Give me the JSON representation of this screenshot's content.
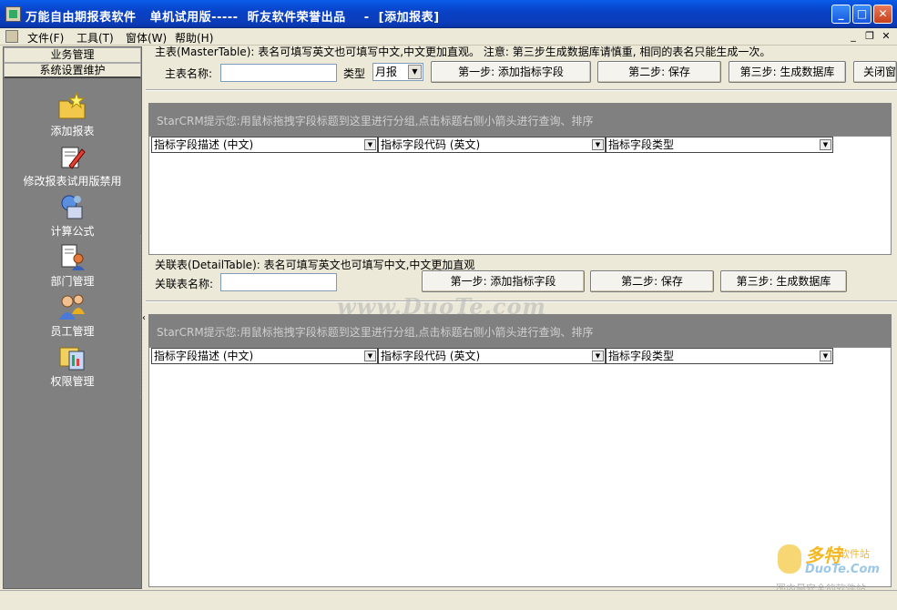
{
  "window": {
    "title": "万能自由期报表软件   单机试用版-----  昕友软件荣誉出品    -  [添加报表]",
    "minimize_glyph": "_",
    "maximize_glyph": "□",
    "close_glyph": "✕"
  },
  "menubar": {
    "items": [
      "文件(F)",
      "工具(T)",
      "窗体(W)",
      "帮助(H)"
    ],
    "mdi_minimize": "_",
    "mdi_restore": "❐",
    "mdi_close": "✕"
  },
  "sidebar": {
    "group_top": "业务管理",
    "group_active": "系统设置维护",
    "items": [
      {
        "label": "添加报表",
        "icon": "folder-star-icon"
      },
      {
        "label": "修改报表试用版禁用",
        "icon": "edit-document-icon"
      },
      {
        "label": "计算公式",
        "icon": "formula-icon"
      },
      {
        "label": "部门管理",
        "icon": "department-icon"
      },
      {
        "label": "员工管理",
        "icon": "employees-icon"
      },
      {
        "label": "权限管理",
        "icon": "permissions-icon"
      }
    ],
    "collapse_arrow": "‹"
  },
  "master": {
    "description": "主表(MasterTable): 表名可填写英文也可填写中文,中文更加直观。 注意: 第三步生成数据库请慎重, 相同的表名只能生成一次。",
    "name_label": "主表名称:",
    "name_value": "",
    "type_label": "类型",
    "type_value": "月报",
    "step1": "第一步: 添加指标字段",
    "step2": "第二步: 保存",
    "step3": "第三步: 生成数据库",
    "close": "关闭窗",
    "hint": "StarCRM提示您:用鼠标拖拽字段标题到这里进行分组,点击标题右侧小箭头进行查询、排序",
    "columns": [
      "指标字段描述 (中文)",
      "指标字段代码 (英文)",
      "指标字段类型"
    ]
  },
  "detail": {
    "description": "关联表(DetailTable): 表名可填写英文也可填写中文,中文更加直观",
    "name_label": "关联表名称:",
    "name_value": "",
    "step1": "第一步: 添加指标字段",
    "step2": "第二步: 保存",
    "step3": "第三步: 生成数据库",
    "hint": "StarCRM提示您:用鼠标拖拽字段标题到这里进行分组,点击标题右侧小箭头进行查询、排序",
    "columns": [
      "指标字段描述 (中文)",
      "指标字段代码 (英文)",
      "指标字段类型"
    ]
  },
  "watermark": {
    "center": "www.DuoTe.com",
    "logo_big": "多特",
    "logo_small": "软件站",
    "logo_url": "DuoTe.Com",
    "logo_foot": "国内最安全的软件站"
  },
  "colors": {
    "title_bar": "#0842c8",
    "sidebar_bg": "#808080",
    "hint_band": "#808080",
    "window_bg": "#ece9d8"
  }
}
